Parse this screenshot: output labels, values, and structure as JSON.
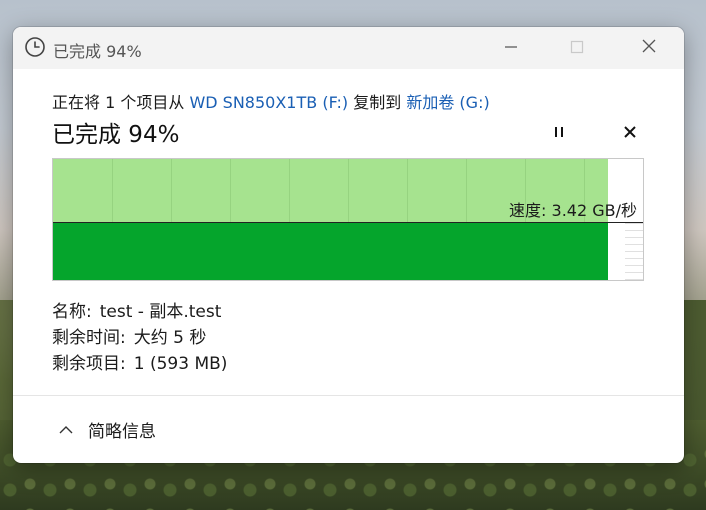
{
  "window": {
    "title": "已完成 94%"
  },
  "dialog": {
    "desc_prefix": "正在将 1 个项目从 ",
    "source": "WD SN850X1TB (F:)",
    "desc_middle": " 复制到 ",
    "destination": "新加卷 (G:)",
    "heading": "已完成 94%",
    "progress_percent": 94,
    "speed_label": "速度: 3.42 GB/秒"
  },
  "details": {
    "name_key": "名称:",
    "name_value": "test - 副本.test",
    "time_key": "剩余时间:",
    "time_value": "大约 5 秒",
    "items_key": "剩余项目:",
    "items_value": "1 (593 MB)"
  },
  "footer": {
    "toggle_label": "简略信息"
  },
  "colors": {
    "progress_fill": "#a6e38f",
    "speed_fill": "#05a52c",
    "link": "#1a5fb4"
  },
  "icons": [
    "clock-icon",
    "minimize-icon",
    "maximize-icon",
    "close-icon",
    "pause-icon",
    "stop-icon",
    "chevron-up-icon"
  ]
}
